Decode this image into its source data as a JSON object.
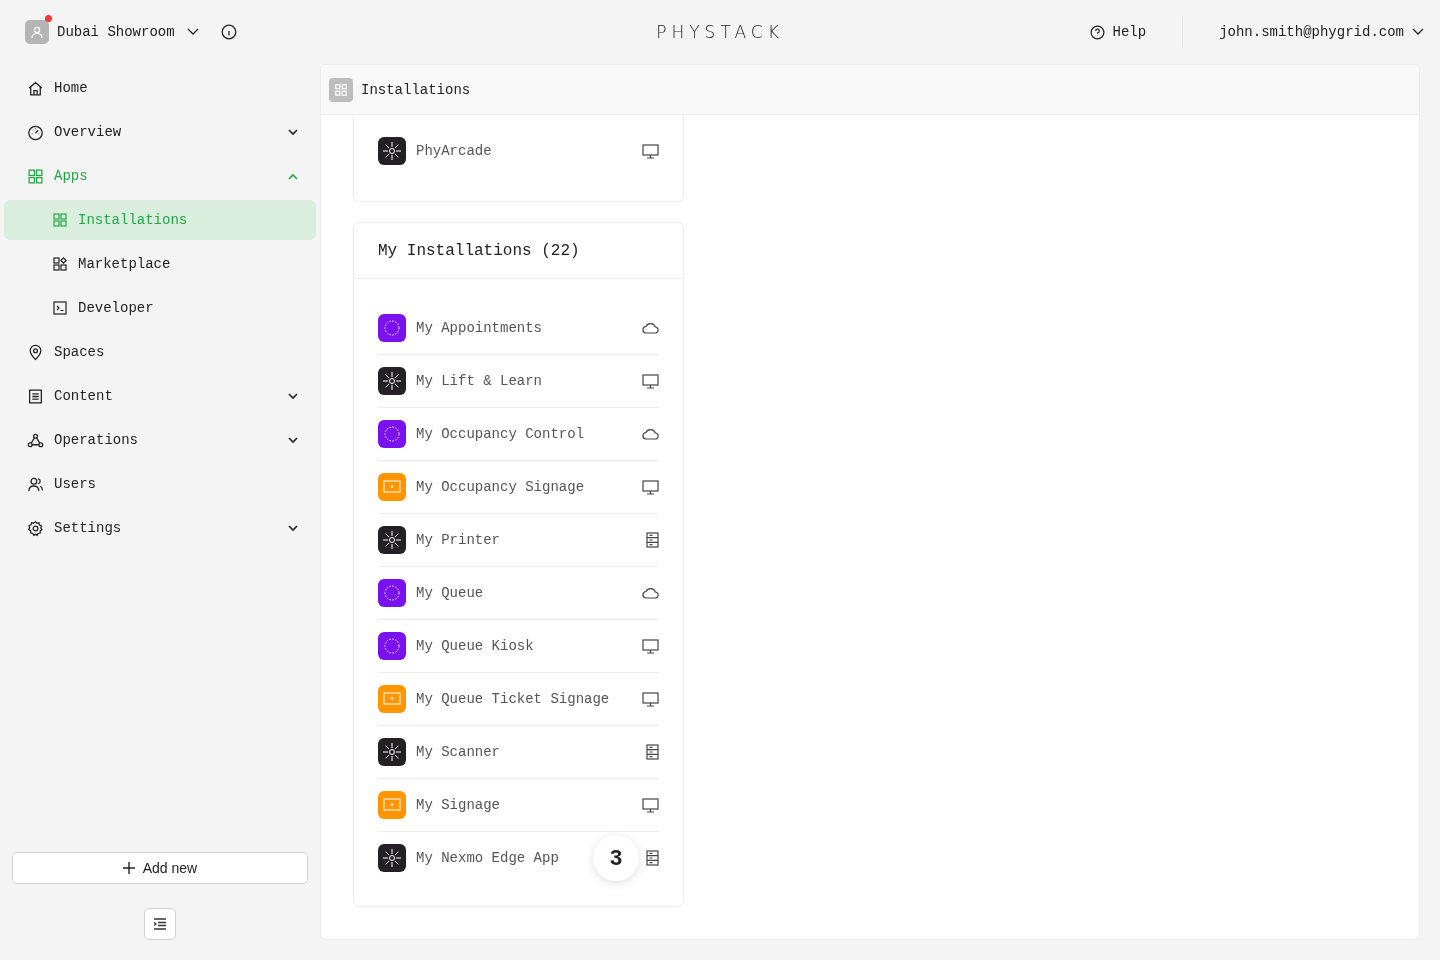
{
  "workspace": {
    "name": "Dubai Showroom",
    "notification": true
  },
  "logo": "PHYSTACK",
  "help": "Help",
  "user": "john.smith@phygrid.com",
  "nav": [
    {
      "label": "Home",
      "selected": false
    },
    {
      "label": "Overview",
      "selected": false,
      "expanded": false
    },
    {
      "label": "Apps",
      "selected": true,
      "expanded": true,
      "children": [
        {
          "label": "Installations",
          "selected": true
        },
        {
          "label": "Marketplace",
          "selected": false
        },
        {
          "label": "Developer",
          "selected": false
        }
      ]
    },
    {
      "label": "Spaces",
      "selected": false
    },
    {
      "label": "Content",
      "selected": false,
      "expanded": false
    },
    {
      "label": "Operations",
      "selected": false,
      "expanded": false
    },
    {
      "label": "Users",
      "selected": false
    },
    {
      "label": "Settings",
      "selected": false,
      "expanded": false
    }
  ],
  "add_button": "Add new",
  "page_title": "Installations",
  "upper_list": [
    {
      "name": "PhyArcade",
      "color": "#232126",
      "kind": "screen"
    }
  ],
  "installations": {
    "title": "My Installations (22)",
    "items": [
      {
        "name": "My Appointments",
        "color": "#7a12f0",
        "kind": "cloud"
      },
      {
        "name": "My Lift & Learn",
        "color": "#232126",
        "kind": "screen"
      },
      {
        "name": "My Occupancy Control",
        "color": "#7a12f0",
        "kind": "cloud"
      },
      {
        "name": "My Occupancy Signage",
        "color": "#ff9500",
        "kind": "screen"
      },
      {
        "name": "My Printer",
        "color": "#232126",
        "kind": "server"
      },
      {
        "name": "My Queue",
        "color": "#7a12f0",
        "kind": "cloud"
      },
      {
        "name": "My Queue Kiosk",
        "color": "#7a12f0",
        "kind": "screen"
      },
      {
        "name": "My Queue Ticket Signage",
        "color": "#ff9500",
        "kind": "screen"
      },
      {
        "name": "My Scanner",
        "color": "#232126",
        "kind": "server"
      },
      {
        "name": "My Signage",
        "color": "#ff9500",
        "kind": "screen"
      },
      {
        "name": "My Nexmo Edge App",
        "color": "#232126",
        "kind": "server"
      }
    ]
  },
  "step_badge": "3"
}
